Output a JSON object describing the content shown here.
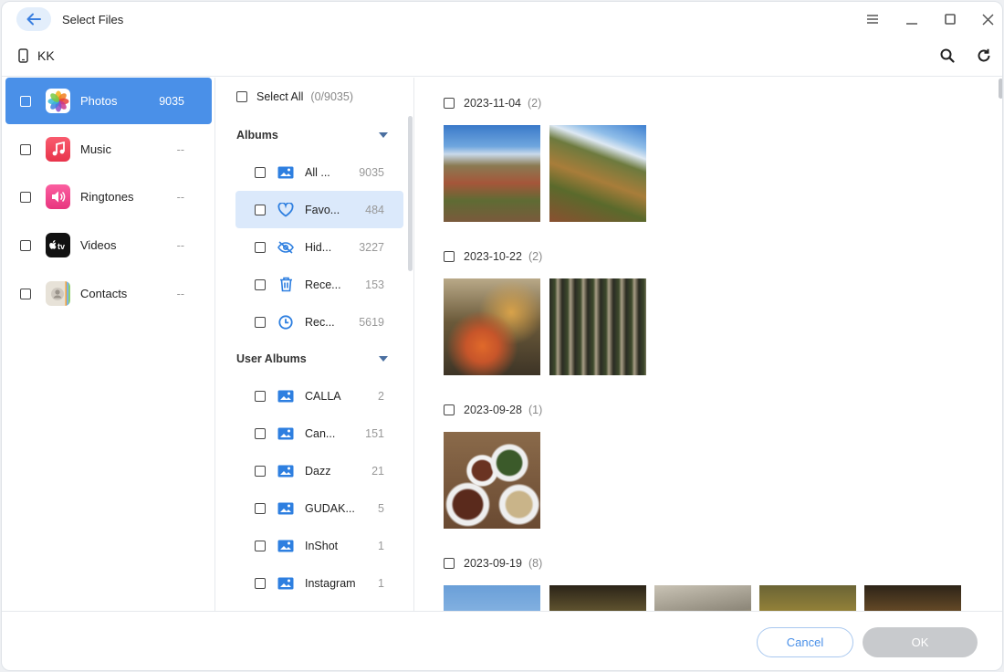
{
  "window": {
    "title": "Select Files"
  },
  "device": {
    "name": "KK"
  },
  "categories": [
    {
      "label": "Photos",
      "count": "9035",
      "icon": "photos-app-icon",
      "active": true
    },
    {
      "label": "Music",
      "count": "--",
      "icon": "music-app-icon"
    },
    {
      "label": "Ringtones",
      "count": "--",
      "icon": "ringtones-app-icon"
    },
    {
      "label": "Videos",
      "count": "--",
      "icon": "tv-app-icon"
    },
    {
      "label": "Contacts",
      "count": "--",
      "icon": "contacts-app-icon"
    }
  ],
  "albums_panel": {
    "select_all_label": "Select All",
    "select_all_count": "(0/9035)",
    "albums_heading": "Albums",
    "user_albums_heading": "User Albums",
    "albums": [
      {
        "label": "All ...",
        "count": "9035",
        "icon": "album-icon"
      },
      {
        "label": "Favo...",
        "count": "484",
        "icon": "heart-icon",
        "active": true
      },
      {
        "label": "Hid...",
        "count": "3227",
        "icon": "hidden-eye-icon"
      },
      {
        "label": "Rece...",
        "count": "153",
        "icon": "trash-icon"
      },
      {
        "label": "Rec...",
        "count": "5619",
        "icon": "clock-icon"
      }
    ],
    "user_albums": [
      {
        "label": "CALLA",
        "count": "2"
      },
      {
        "label": "Can...",
        "count": "151"
      },
      {
        "label": "Dazz",
        "count": "21"
      },
      {
        "label": "GUDAK...",
        "count": "5"
      },
      {
        "label": "InShot",
        "count": "1"
      },
      {
        "label": "Instagram",
        "count": "1"
      }
    ]
  },
  "photo_groups": [
    {
      "date": "2023-11-04",
      "count": "(2)",
      "photos": [
        "mountain-autumn-sky",
        "mountain-autumn-slope"
      ]
    },
    {
      "date": "2023-10-22",
      "count": "(2)",
      "photos": [
        "autumn-maple-trees",
        "wind-chimes-shrine"
      ]
    },
    {
      "date": "2023-09-28",
      "count": "(1)",
      "photos": [
        "food-table-dishes"
      ]
    },
    {
      "date": "2023-09-19",
      "count": "(8)",
      "photos": [
        "sky-photo",
        "trees-photo",
        "rocks-photo",
        "yellow-leaves-photo",
        "stream-photo"
      ]
    }
  ],
  "footer": {
    "cancel_label": "Cancel",
    "ok_label": "OK"
  },
  "colors": {
    "accent": "#4a90e8",
    "active_album_bg": "#dbe9fb",
    "ok_disabled": "#c8cacd"
  }
}
